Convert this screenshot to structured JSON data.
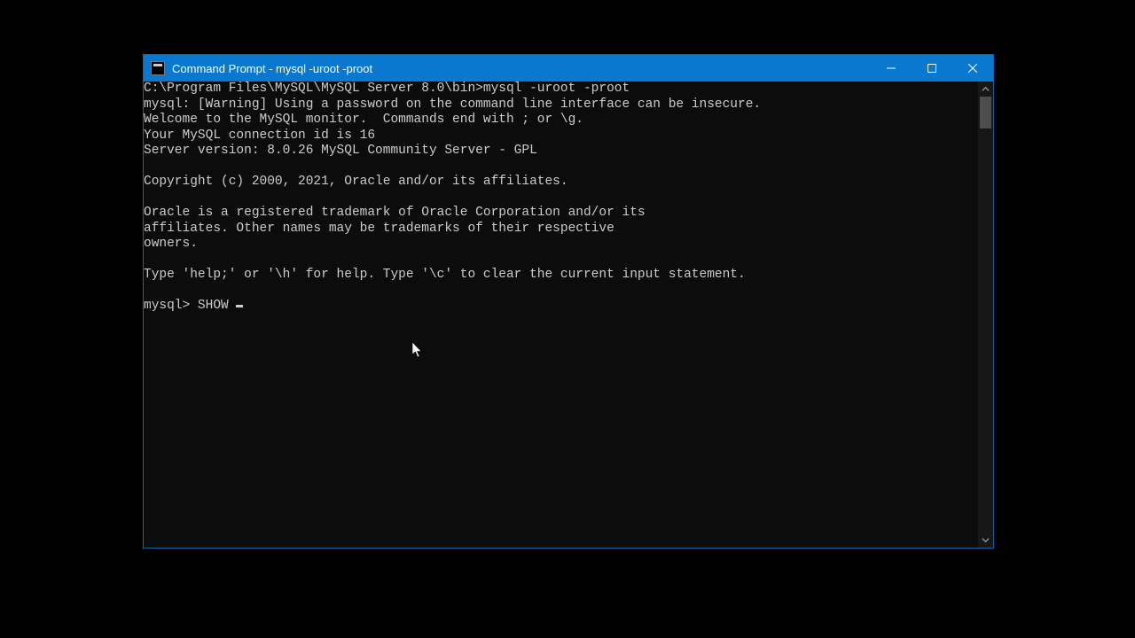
{
  "titlebar": {
    "title": "Command Prompt - mysql  -uroot -proot"
  },
  "terminal": {
    "lines": [
      "C:\\Program Files\\MySQL\\MySQL Server 8.0\\bin>mysql -uroot -proot",
      "mysql: [Warning] Using a password on the command line interface can be insecure.",
      "Welcome to the MySQL monitor.  Commands end with ; or \\g.",
      "Your MySQL connection id is 16",
      "Server version: 8.0.26 MySQL Community Server - GPL",
      "",
      "Copyright (c) 2000, 2021, Oracle and/or its affiliates.",
      "",
      "Oracle is a registered trademark of Oracle Corporation and/or its",
      "affiliates. Other names may be trademarks of their respective",
      "owners.",
      "",
      "Type 'help;' or '\\h' for help. Type '\\c' to clear the current input statement.",
      ""
    ],
    "prompt": "mysql> ",
    "input": "SHOW "
  }
}
